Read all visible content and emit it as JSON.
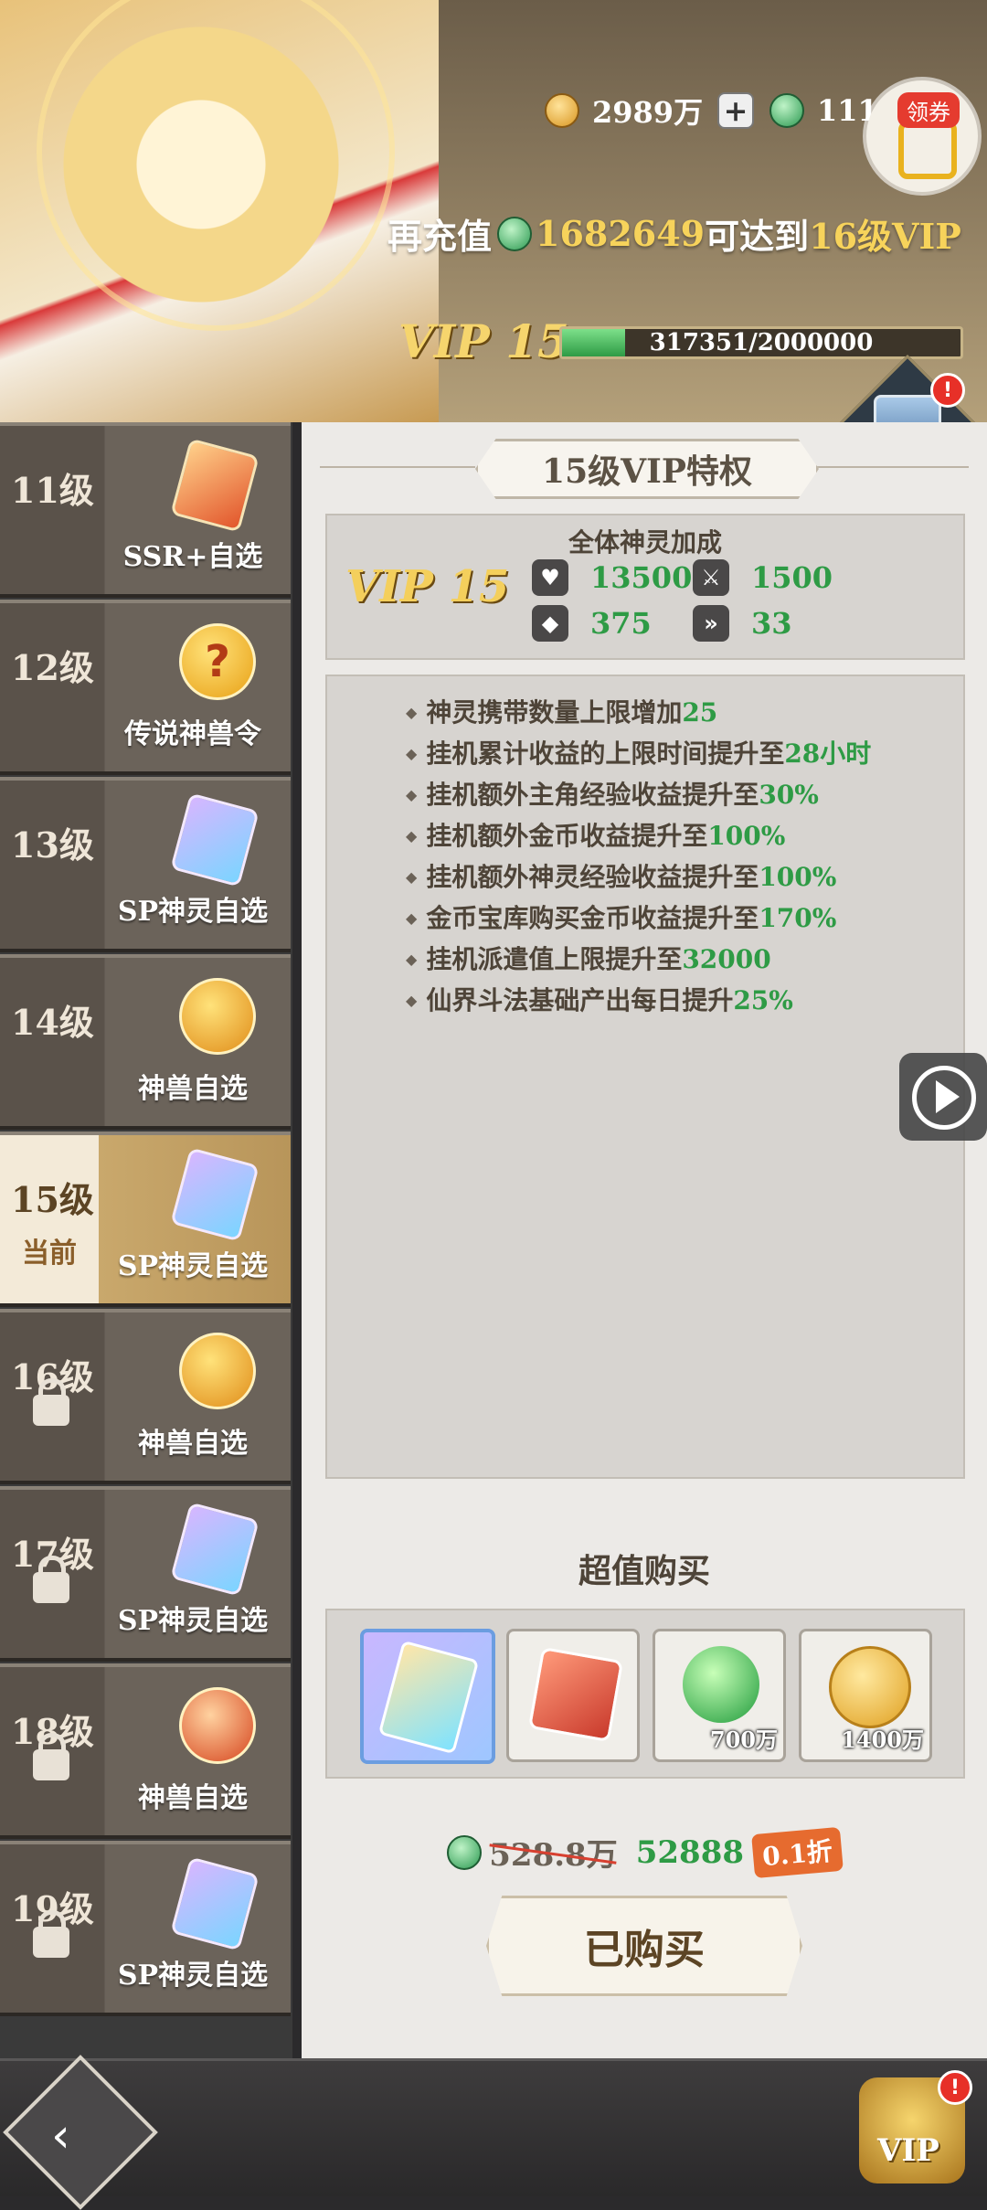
{
  "header": {
    "gold_amount": "2989万",
    "jade_amount": "11167",
    "coupon_label": "领券",
    "recharge_prefix": "再充值",
    "recharge_amount": "1682649",
    "recharge_middle": "可达到",
    "recharge_target": "16级VIP",
    "vip_label": "VIP 15",
    "vip_progress_text": "317351/2000000",
    "vip_progress_fraction": 0.1587,
    "chest_badge": "!"
  },
  "levels": [
    {
      "name": "11级",
      "reward": "SSR+自选",
      "icon": "ssr-card-icon",
      "current": false,
      "locked": false
    },
    {
      "name": "12级",
      "reward": "传说神兽令",
      "icon": "beast-token-icon",
      "current": false,
      "locked": false
    },
    {
      "name": "13级",
      "reward": "SP神灵自选",
      "icon": "sp-card-icon",
      "current": false,
      "locked": false
    },
    {
      "name": "14级",
      "reward": "神兽自选",
      "icon": "dragon-coin-icon",
      "current": false,
      "locked": false
    },
    {
      "name": "15级",
      "sub": "当前",
      "reward": "SP神灵自选",
      "icon": "sp-card-icon",
      "current": true,
      "locked": false
    },
    {
      "name": "16级",
      "reward": "神兽自选",
      "icon": "dragon-coin-icon",
      "current": false,
      "locked": true
    },
    {
      "name": "17级",
      "reward": "SP神灵自选",
      "icon": "sp-card-icon",
      "current": false,
      "locked": true
    },
    {
      "name": "18级",
      "reward": "神兽自选",
      "icon": "dragon-coin-red-icon",
      "current": false,
      "locked": true
    },
    {
      "name": "19级",
      "reward": "SP神灵自选",
      "icon": "sp-card-icon",
      "current": false,
      "locked": true
    }
  ],
  "panel": {
    "title": "15级VIP特权",
    "bonus_title": "全体神灵加成",
    "bonus_vip": "VIP 15",
    "stats": [
      {
        "icon": "shield-heart-icon",
        "value": "13500"
      },
      {
        "icon": "sword-icon",
        "value": "1500"
      },
      {
        "icon": "armor-icon",
        "value": "375"
      },
      {
        "icon": "boot-icon",
        "value": "33"
      }
    ],
    "privileges": [
      {
        "text": "神灵携带数量上限增加",
        "value": "25"
      },
      {
        "text": "挂机累计收益的上限时间提升至",
        "value": "28小时"
      },
      {
        "text": "挂机额外主角经验收益提升至",
        "value": "30%"
      },
      {
        "text": "挂机额外金币收益提升至",
        "value": "100%"
      },
      {
        "text": "挂机额外神灵经验收益提升至",
        "value": "100%"
      },
      {
        "text": "金币宝库购买金币收益提升至",
        "value": "170%"
      },
      {
        "text": "挂机派遣值上限提升至",
        "value": "32000"
      },
      {
        "text": "仙界斗法基础产出每日提升",
        "value": "25%"
      }
    ],
    "deal_title": "超值购买",
    "deal_items": [
      {
        "icon": "sp-card-icon",
        "qty": ""
      },
      {
        "icon": "gift-box-icon",
        "qty": ""
      },
      {
        "icon": "exp-orb-icon",
        "qty": "700万"
      },
      {
        "icon": "gold-coin-icon",
        "qty": "1400万"
      }
    ],
    "old_price": "528.8万",
    "new_price": "52888",
    "discount": "0.1折",
    "buy_label": "已购买"
  },
  "bottom": {
    "vip_label": "VIP",
    "vip_badge": "!"
  }
}
